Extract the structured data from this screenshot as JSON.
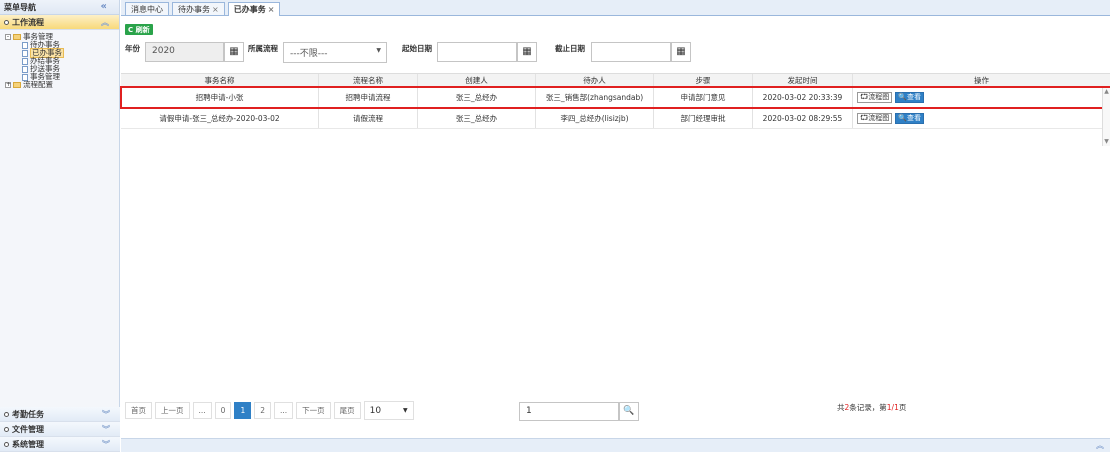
{
  "sidebar": {
    "title": "菜单导航",
    "collapse": "«",
    "active_panel": "工作流程",
    "tree": {
      "root": "事务管理",
      "items": [
        "待办事务",
        "已办事务",
        "办结事务",
        "抄送事务",
        "事务管理"
      ],
      "root2": "流程配置"
    },
    "bottom_panels": [
      "考勤任务",
      "文件管理",
      "系统管理"
    ]
  },
  "tabs": [
    {
      "label": "消息中心",
      "close": ""
    },
    {
      "label": "待办事务",
      "close": "×"
    },
    {
      "label": "已办事务",
      "close": "×"
    }
  ],
  "toolbar": {
    "refresh": "C 刷新",
    "year_label": "年份",
    "year_value": "2020",
    "flow_label": "所属流程",
    "flow_value": "---不限---",
    "start_label": "起始日期",
    "end_label": "截止日期"
  },
  "table": {
    "headers": [
      "事务名称",
      "流程名称",
      "创建人",
      "待办人",
      "步骤",
      "发起时间",
      "操作"
    ],
    "rows": [
      [
        "招聘申请-小张",
        "招聘申请流程",
        "张三_总经办",
        "张三_销售部(zhangsandab)",
        "申请部门意见",
        "2020-03-02 20:33:39"
      ],
      [
        "请假申请-张三_总经办-2020-03-02",
        "请假流程",
        "张三_总经办",
        "李四_总经办(lisizjb)",
        "部门经理审批",
        "2020-03-02 08:29:55"
      ]
    ],
    "op_flow": "⮔流程图",
    "op_view": "🔍查看"
  },
  "pager": {
    "first": "首页",
    "prev": "上一页",
    "dots": "...",
    "p0": "0",
    "p1": "1",
    "p2": "2",
    "next": "下一页",
    "last": "尾页",
    "size": "10",
    "goto": "1",
    "summary_a": "共",
    "summary_b": "2",
    "summary_c": "条记录，第",
    "summary_d": "1/1",
    "summary_e": "页"
  }
}
